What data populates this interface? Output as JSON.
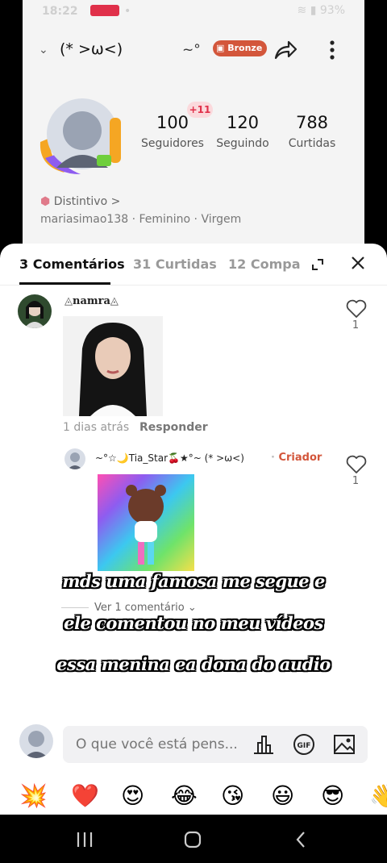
{
  "status_bar": {
    "time": "18:22",
    "battery": "93%"
  },
  "profile": {
    "name": "(* >ω<)",
    "rank_decoration": "~°",
    "badge": "Bronze",
    "new_followers_badge": "+11",
    "stats": [
      {
        "value": "100",
        "label": "Seguidores"
      },
      {
        "value": "120",
        "label": "Seguindo"
      },
      {
        "value": "788",
        "label": "Curtidas"
      }
    ],
    "distintivo": "Distintivo >",
    "meta": "mariasimao138  ·  Feminino  ·  Virgem"
  },
  "tabs": [
    {
      "label": "3 Comentários",
      "active": true
    },
    {
      "label": "31 Curtidas",
      "active": false
    },
    {
      "label": "12 Compa",
      "active": false
    }
  ],
  "comments": [
    {
      "author": "namra",
      "likes": "1",
      "time": "1 dias atrás",
      "reply_label": "Responder"
    },
    {
      "author": "~°☆🌙Tia_Star🍒★°~  (* >ω<)",
      "role": "Criador",
      "likes": "1"
    }
  ],
  "see_replies": "Ver 1 comentário",
  "caption_lines": [
    "mds uma famosa me segue e",
    "ele comentou no meu vídeos",
    "essa menina ea dona do audio"
  ],
  "composer": {
    "placeholder": "O que você está pens..."
  },
  "emojis": [
    "💥",
    "❤️",
    "😍",
    "😂",
    "😘",
    "😃",
    "😎",
    "👋"
  ],
  "colors": {
    "accent": "#d3563b",
    "notification": "#e0304a"
  }
}
